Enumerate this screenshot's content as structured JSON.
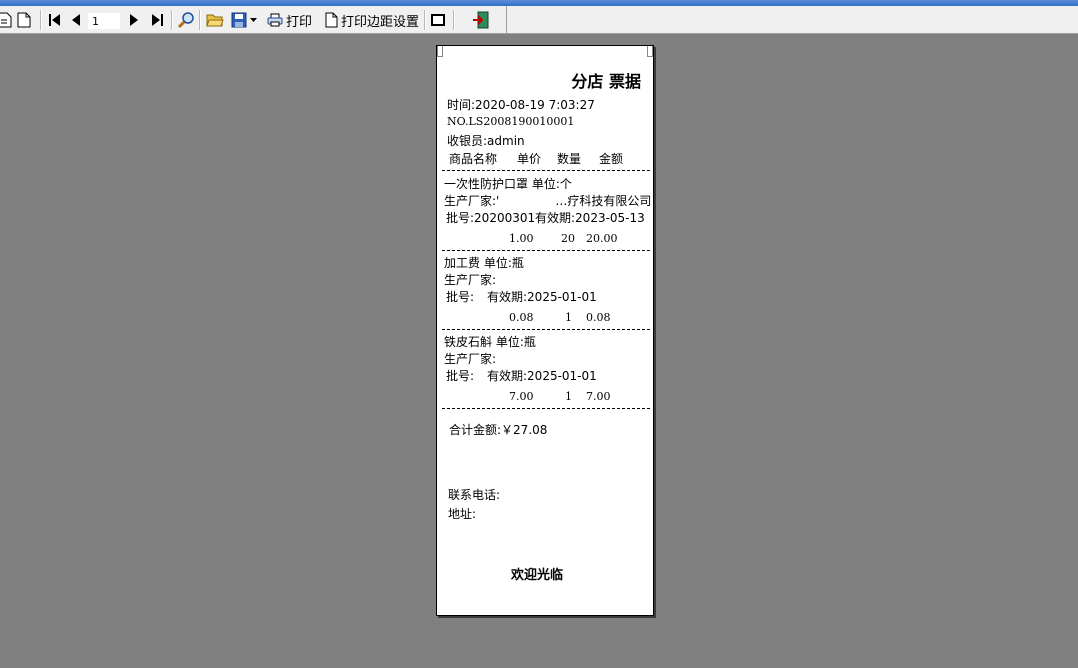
{
  "toolbar": {
    "page_number": "1",
    "print_label": "打印",
    "margin_settings_label": "打印边距设置"
  },
  "receipt": {
    "title": "分店 票据",
    "time": "时间:2020-08-19 7:03:27",
    "number": "NO.LS2008190010001",
    "cashier": "收银员:admin",
    "headers": {
      "name": "商品名称",
      "price": "单价",
      "qty": "数量",
      "amount": "金额"
    },
    "items": [
      {
        "name_unit": "一次性防护口罩 单位:个",
        "maker_prefix": "生产厂家:'",
        "maker_suffix": "…疗科技有限公司",
        "batch": "批号:20200301",
        "expiry": "有效期:2023-05-13",
        "price": "1.00",
        "qty": "20",
        "amount": "20.00"
      },
      {
        "name_unit": "加工费 单位:瓶",
        "maker_prefix": "生产厂家:",
        "maker_suffix": "",
        "batch": "批号:",
        "expiry": "有效期:2025-01-01",
        "price": "0.08",
        "qty": "1",
        "amount": "0.08"
      },
      {
        "name_unit": "铁皮石斛 单位:瓶",
        "maker_prefix": "生产厂家:",
        "maker_suffix": "",
        "batch": "批号:",
        "expiry": "有效期:2025-01-01",
        "price": "7.00",
        "qty": "1",
        "amount": "7.00"
      }
    ],
    "total": "合计金额:￥27.08",
    "phone": "联系电话:",
    "address": "地址:",
    "welcome": "欢迎光临"
  }
}
